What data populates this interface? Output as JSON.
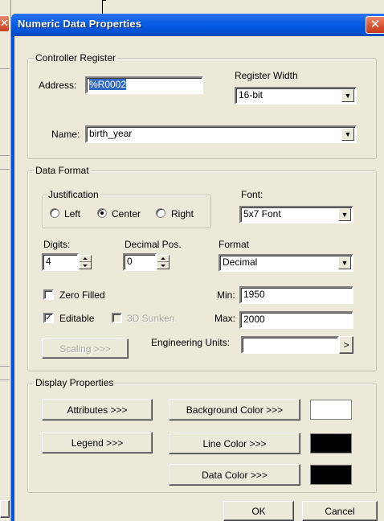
{
  "window": {
    "title": "Numeric Data Properties",
    "close_glyph": "✕",
    "background_close_glyph": "✕"
  },
  "controller_register": {
    "group_title": "Controller Register",
    "address_label": "Address:",
    "address_value": "%R0002",
    "register_width_label": "Register Width",
    "register_width_value": "16-bit",
    "name_label": "Name:",
    "name_value": "birth_year"
  },
  "data_format": {
    "group_title": "Data Format",
    "justification": {
      "title": "Justification",
      "options": [
        "Left",
        "Center",
        "Right"
      ],
      "selected": "Center"
    },
    "font_label": "Font:",
    "font_value": "5x7 Font",
    "digits_label": "Digits:",
    "digits_value": "4",
    "decimal_pos_label": "Decimal Pos.",
    "decimal_pos_value": "0",
    "format_label": "Format",
    "format_value": "Decimal",
    "zero_filled_label": "Zero Filled",
    "zero_filled_checked": false,
    "editable_label": "Editable",
    "editable_checked": true,
    "sunken_label": "3D Sunken",
    "sunken_checked": false,
    "min_label": "Min:",
    "min_value": "1950",
    "max_label": "Max:",
    "max_value": "2000",
    "scaling_button": "Scaling >>>",
    "engineering_units_label": "Engineering Units:",
    "engineering_units_value": "",
    "engineering_units_button": ">"
  },
  "display_properties": {
    "group_title": "Display Properties",
    "attributes_button": "Attributes >>>",
    "legend_button": "Legend >>>",
    "background_color_button": "Background Color >>>",
    "line_color_button": "Line Color >>>",
    "data_color_button": "Data Color >>>",
    "background_color": "#ffffff",
    "line_color": "#000000",
    "data_color": "#000000"
  },
  "footer": {
    "ok_button": "OK",
    "cancel_button": "Cancel"
  },
  "colors": {
    "title_bar": "#0054e3",
    "dialog_face": "#ece9d8",
    "selection": "#316ac5"
  }
}
